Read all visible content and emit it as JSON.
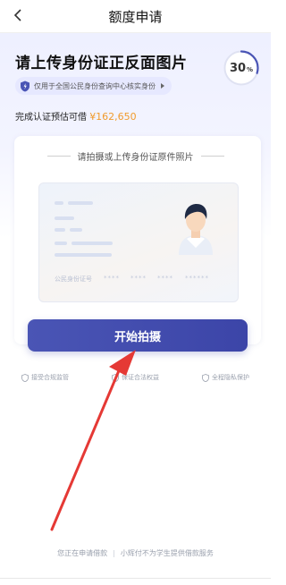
{
  "header": {
    "title": "额度申请"
  },
  "hero": {
    "heading": "请上传身份证正反面图片",
    "notice": "仅用于全国公民身份查询中心核实身份",
    "progress": {
      "value": "30",
      "unit": "%"
    },
    "estimate_label": "完成认证预估可借",
    "estimate_amount": "¥162,650"
  },
  "card": {
    "title": "请拍摄或上传身份证原件照片",
    "id_number_label": "公民身份证号",
    "masked_groups": [
      "****",
      "****",
      "****",
      "******"
    ]
  },
  "button": {
    "label": "开始拍摄"
  },
  "features": [
    {
      "label": "接受合规监管"
    },
    {
      "label": "保证合法权益"
    },
    {
      "label": "全程隐私保护"
    }
  ],
  "footer": {
    "left": "您正在申请借款",
    "right": "小辉付不为学生提供借款服务"
  },
  "colors": {
    "accent": "#4a55b5",
    "amount": "#f19b2c",
    "arrow": "#e53935"
  }
}
